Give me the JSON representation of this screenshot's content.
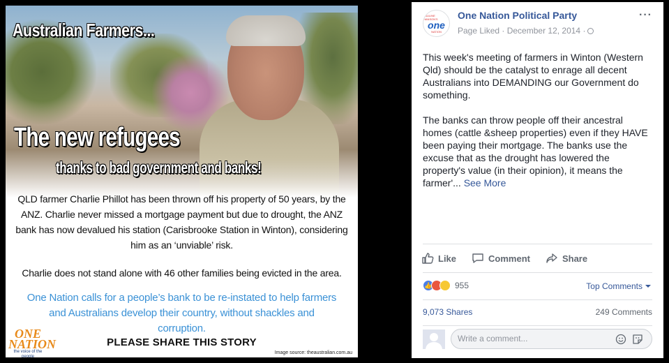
{
  "image": {
    "headline_top": "Australian Farmers...",
    "headline_main": "The new refugees",
    "headline_sub": "thanks to bad government and banks!",
    "body_paragraph_1": "QLD farmer Charlie Phillot has been thrown off his property of 50 years, by the ANZ. Charlie never missed a mortgage payment but due to drought, the ANZ bank has now devalued his station (Carisbrooke Station in Winton), considering him as an ‘unviable’ risk.",
    "body_paragraph_2": "Charlie does not stand alone with 46 other families being evicted in the area.",
    "body_paragraph_3": "One Nation calls for a people’s bank to be re-instated to help farmers and Australians develop their country, without shackles and corruption.",
    "share_cta": "PLEASE SHARE THIS STORY",
    "logo_text": "ONE NATION",
    "logo_tagline": "the voice of the people",
    "image_source": "Image source: theaustralian.com.au"
  },
  "post": {
    "avatar": {
      "top": "PAULINE HANSON'S",
      "main": "one",
      "bottom": "NATION"
    },
    "page_name": "One Nation Political Party",
    "meta": "Page Liked · December 12, 2014 ·",
    "text_paragraph_1": "This week's meeting of farmers in Winton (Western Qld) should be the catalyst to enrage all decent Australians into DEMANDING our Government do something.",
    "text_paragraph_2": "The banks can throw people off their ancestral homes (cattle &sheep properties) even if they HAVE been paying their mortgage. The banks use the excuse that as the drought has lowered the property's value (in their opinion), it means the farmer'...",
    "see_more": "See More",
    "actions": {
      "like": "Like",
      "comment": "Comment",
      "share": "Share"
    },
    "reaction_count": "955",
    "top_comments": "Top Comments",
    "shares": "9,073 Shares",
    "comments": "249 Comments",
    "comment_placeholder": "Write a comment..."
  },
  "colors": {
    "link": "#365899",
    "accent_blue_text": "#3a91d6",
    "background": "#000000"
  }
}
